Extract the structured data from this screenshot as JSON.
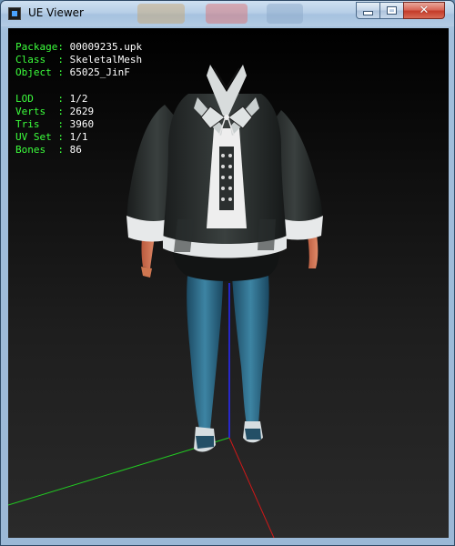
{
  "window": {
    "title": "UE Viewer",
    "buttons": {
      "minimize": "—",
      "maximize": "□",
      "close": "✕"
    }
  },
  "info": {
    "package": {
      "label": "Package:",
      "value": "00009235.upk"
    },
    "class": {
      "label": "Class  :",
      "value": "SkeletalMesh"
    },
    "object": {
      "label": "Object :",
      "value": "65025_JinF"
    },
    "lod": {
      "label": "LOD    :",
      "value": "1/2"
    },
    "verts": {
      "label": "Verts  :",
      "value": "2629"
    },
    "tris": {
      "label": "Tris   :",
      "value": "3960"
    },
    "uvset": {
      "label": "UV Set :",
      "value": "1/1"
    },
    "bones": {
      "label": "Bones  :",
      "value": "86"
    }
  },
  "colors": {
    "label_green": "#3cff3c",
    "axis_x": "#d01818",
    "axis_y": "#22cc22",
    "axis_z": "#2a2aff"
  }
}
